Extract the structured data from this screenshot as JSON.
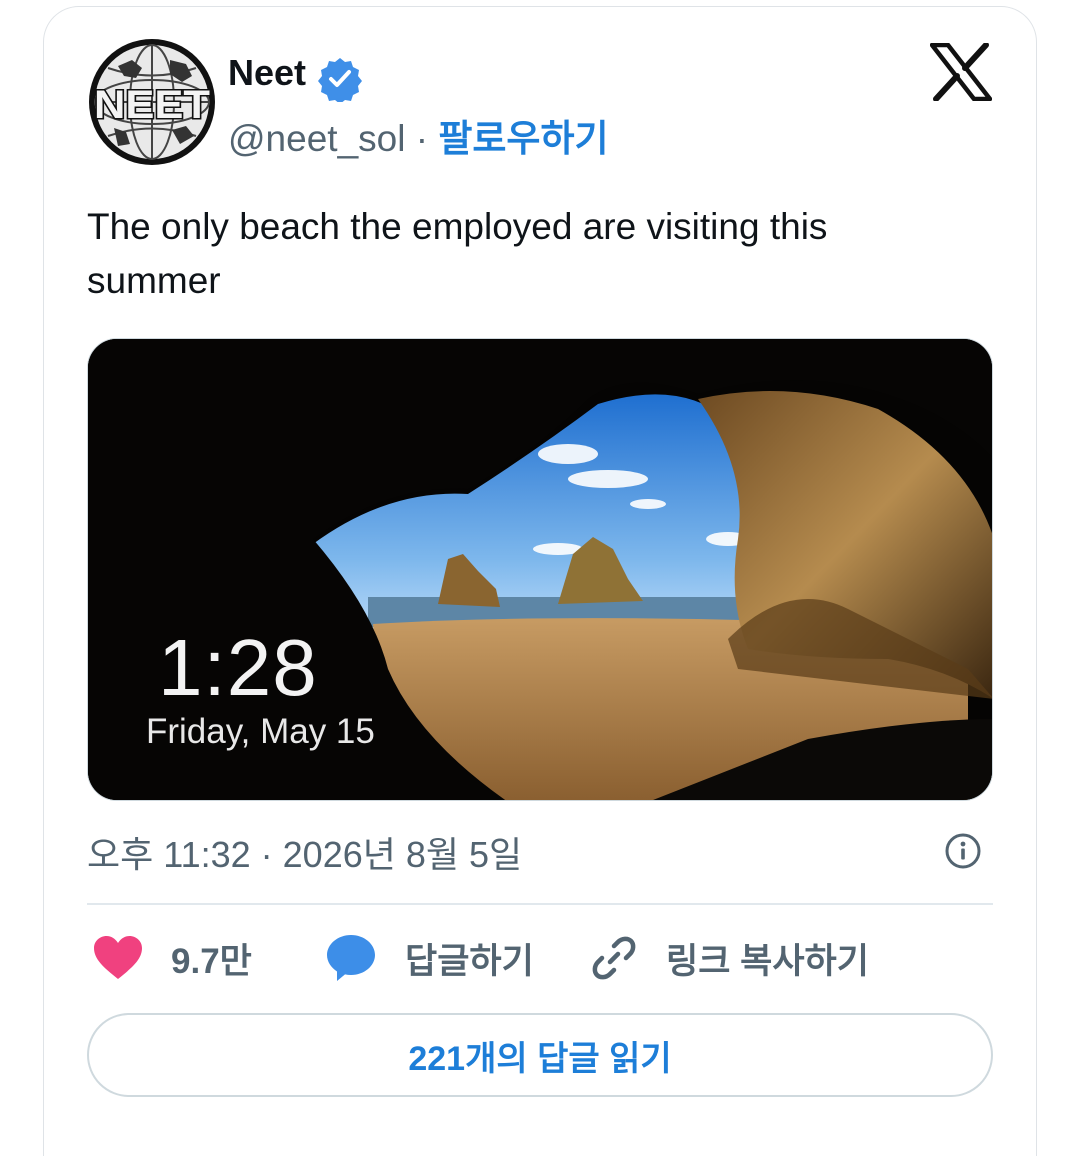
{
  "author": {
    "name": "Neet",
    "handle": "@neet_sol",
    "separator": "·",
    "follow_label": "팔로우하기",
    "avatar_text": "NEET"
  },
  "tweet": {
    "text": "The only beach the employed are visiting this summer",
    "timestamp": "오후 11:32 · 2026년 8월 5일"
  },
  "media": {
    "lock_time": "1:28",
    "lock_date": "Friday, May 15"
  },
  "actions": {
    "likes": "9.7만",
    "reply_label": "답글하기",
    "copy_link_label": "링크 복사하기"
  },
  "read_replies_label": "221개의 답글 읽기",
  "colors": {
    "accent": "#1d7ed8",
    "heart": "#f0417f",
    "reply_bubble": "#3d8ee8",
    "verified": "#3f8fe8",
    "muted": "#536471"
  },
  "icons": [
    "x-logo-icon",
    "verified-badge-icon",
    "info-icon",
    "heart-icon",
    "reply-icon",
    "link-icon"
  ]
}
